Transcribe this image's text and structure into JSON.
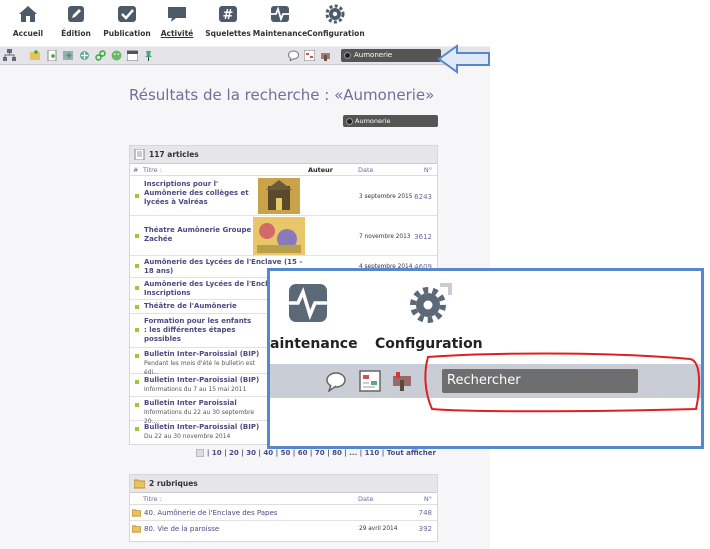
{
  "nav": {
    "items": [
      {
        "label": "Accueil",
        "icon": "home-icon"
      },
      {
        "label": "Édition",
        "icon": "pencil-icon"
      },
      {
        "label": "Publication",
        "icon": "checkmark-icon"
      },
      {
        "label": "Activité",
        "icon": "speech-bubble-icon"
      },
      {
        "label": "Squelettes",
        "icon": "hash-icon"
      },
      {
        "label": "Maintenance",
        "icon": "pulse-icon"
      },
      {
        "label": "Configuration",
        "icon": "gear-icon"
      }
    ],
    "active": "Activité"
  },
  "search": {
    "value": "Aumonerie"
  },
  "page": {
    "title": "Résultats de la recherche : «Aumonerie»"
  },
  "articles": {
    "header": "117 articles",
    "columns": {
      "hash": "#",
      "title": "Titre :",
      "author": "Auteur",
      "date": "Date",
      "num": "N°"
    },
    "rows": [
      {
        "title": "Inscriptions pour l' Aumônerie des collèges et lycées à Valréas",
        "sub": "",
        "date": "3 septembre 2015",
        "num": "6243"
      },
      {
        "title": "Théatre Aumônerie Groupe Zachée",
        "sub": "",
        "date": "7 novembre 2013",
        "num": "3612"
      },
      {
        "title": "Aumônerie des Lycées de l'Enclave (15 - 18 ans)",
        "sub": "",
        "date": "4 septembre 2014",
        "num": "4609"
      },
      {
        "title": "Aumônerie des Lycées de l'Enclave Inscriptions",
        "sub": "",
        "date": "",
        "num": ""
      },
      {
        "title": "Théâtre de l'Aumônerie",
        "sub": "",
        "date": "",
        "num": ""
      },
      {
        "title": "Formation pour les enfants : les différentes étapes possibles",
        "sub": "",
        "date": "",
        "num": ""
      },
      {
        "title": "Bulletin Inter-Paroissial (BIP)",
        "sub": "Pendant les mois d'été le bulletin est édi...",
        "date": "",
        "num": ""
      },
      {
        "title": "Bulletin Inter-Paroissial (BIP)",
        "sub": "Informations du 7 au 15 mai 2011",
        "date": "",
        "num": ""
      },
      {
        "title": "Bulletin Inter Paroissial",
        "sub": "Informations du 22 au 30 septembre 20...",
        "date": "",
        "num": ""
      },
      {
        "title": "Bulletin Inter-Paroissial (BIP)",
        "sub": "Du 22 au 30 novembre 2014",
        "date": "",
        "num": ""
      }
    ],
    "pager": "| 10 | 20 | 30 | 40 | 50 | 60 | 70 | 80 | ... | 110 | Tout afficher"
  },
  "rubriques": {
    "header": "2 rubriques",
    "columns": {
      "title": "Titre :",
      "date": "Date",
      "num": "N°"
    },
    "rows": [
      {
        "title": "40. Aumônerie de l'Enclave des Papes",
        "date": "",
        "num": "748"
      },
      {
        "title": "80. Vie de la paroisse",
        "date": "29 avril 2014",
        "num": "392"
      }
    ]
  },
  "zoom": {
    "maintenance_label": "aintenance",
    "configuration_label": "Configuration",
    "search_placeholder": "Rechercher"
  },
  "colors": {
    "accent": "#6f6f9c",
    "highlight_border": "#5588cc",
    "annotation": "#e02020",
    "bullet": "#99cc33"
  }
}
